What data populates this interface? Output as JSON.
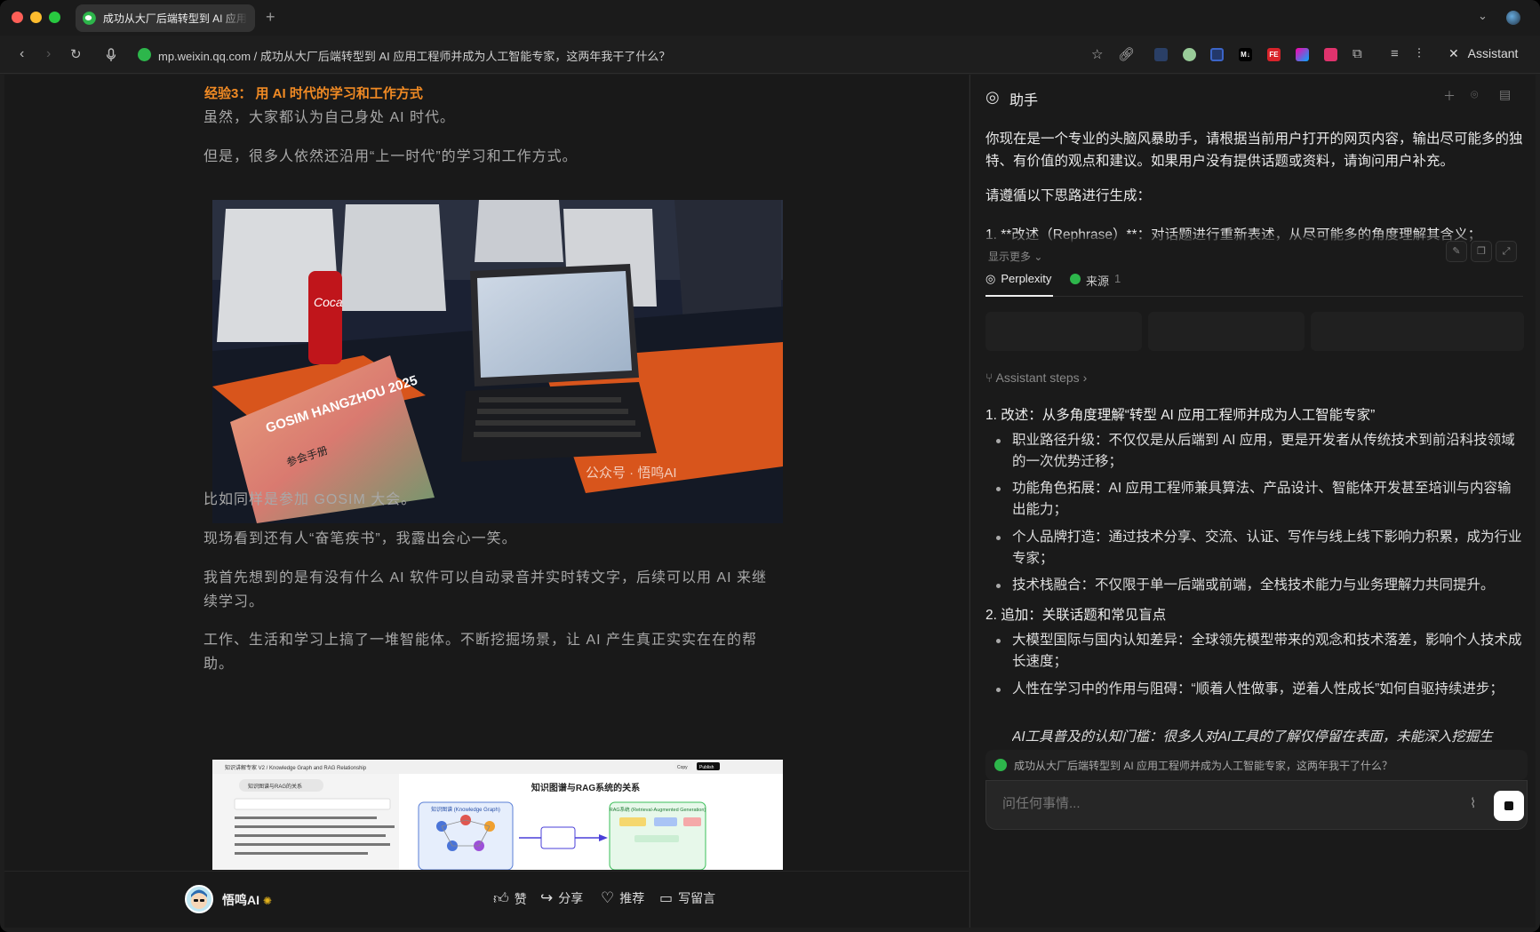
{
  "browser": {
    "tab_title": "成功从大厂后端转型到 AI 应用工程师并成为人工智能专家，这两年我干了什么？",
    "new_tab_label": "+",
    "url_host": "mp.weixin.qq.com",
    "url_path": " / 成功从大厂后端转型到 AI 应用工程师并成为人工智能专家，这两年我干了什么？",
    "assistant_button_label": "Assistant",
    "extensions": [
      "M↓",
      "FE"
    ]
  },
  "article": {
    "heading": "经验3： 用 AI 时代的学习和工作方式",
    "paragraphs_top": [
      "虽然，大家都认为自己身处  AI  时代。",
      "但是，很多人依然还沿用“上一时代”的学习和工作方式。"
    ],
    "photo1": {
      "booklet_title": "GOSIM HANGZHOU 2025",
      "booklet_sub": "参会手册",
      "watermark": "公众号 · 悟鸣AI"
    },
    "paragraphs_bottom": [
      "比如同样是参加  GOSIM  大会。",
      "现场看到还有人“奋笔疾书”，我露出会心一笑。",
      "我首先想到的是有没有什么  AI  软件可以自动录音并实时转文字，后续可以用  AI  来继续学习。",
      "工作、生活和学习上搞了一堆智能体。不断挖掘场景，让  AI  产生真正实实在在的帮助。"
    ],
    "photo2": {
      "title": "知识图谱与RAG系统的关系",
      "left_label": "知识图谱 (Knowledge Graph)",
      "right_label": "RAG系统 (Retrieval-Augmented Generation)",
      "sidebar_chip": "知识图谱与RAG的关系",
      "tab_text": "知识讲解专家 V2 / Knowledge Graph and RAG Relationship",
      "copy_label": "Copy",
      "publish_label": "Publish"
    },
    "footer": {
      "author": "悟鸣AI",
      "like": "赞",
      "share": "分享",
      "recommend": "推荐",
      "comment": "写留言"
    }
  },
  "assistant": {
    "title": "助手",
    "prompt_lines": [
      "你现在是一个专业的头脑风暴助手，请根据当前用户打开的网页内容，输出尽可能多的独特、有价值的观点和建议。如果用户没有提供话题或资料，请询问用户补充。",
      "请遵循以下思路进行生成：",
      "1. **改述（Rephrase）**：对话题进行重新表述，从尽可能多的角度理解其含义；"
    ],
    "show_more": "显示更多",
    "tabs": {
      "perplexity": "Perplexity",
      "sources": "来源",
      "sources_count": "1"
    },
    "steps_label": "Assistant steps",
    "section1_title": "1. 改述：从多角度理解“转型 AI 应用工程师并成为人工智能专家”",
    "section1_bullets": [
      "职业路径升级：不仅仅是从后端到 AI 应用，更是开发者从传统技术到前沿科技领域的一次优势迁移；",
      "功能角色拓展：AI 应用工程师兼具算法、产品设计、智能体开发甚至培训与内容输出能力；",
      "个人品牌打造：通过技术分享、交流、认证、写作与线上线下影响力积累，成为行业专家；",
      "技术栈融合：不仅限于单一后端或前端，全栈技术能力与业务理解力共同提升。"
    ],
    "section2_title": "2. 追加：关联话题和常见盲点",
    "section2_bullets": [
      "大模型国际与国内认知差异：全球领先模型带来的观念和技术落差，影响个人技术成长速度；",
      "人性在学习中的作用与阻碍：“顺着人性做事，逆着人性成长”如何自驱持续进步；",
      "AI工具普及的认知门槛：很多人对AI工具的了解仅停留在表面，未能深入挖掘生"
    ],
    "context_chip": "成功从大厂后端转型到 AI 应用工程师并成为人工智能专家，这两年我干了什么？",
    "input_placeholder": "问任何事情..."
  }
}
